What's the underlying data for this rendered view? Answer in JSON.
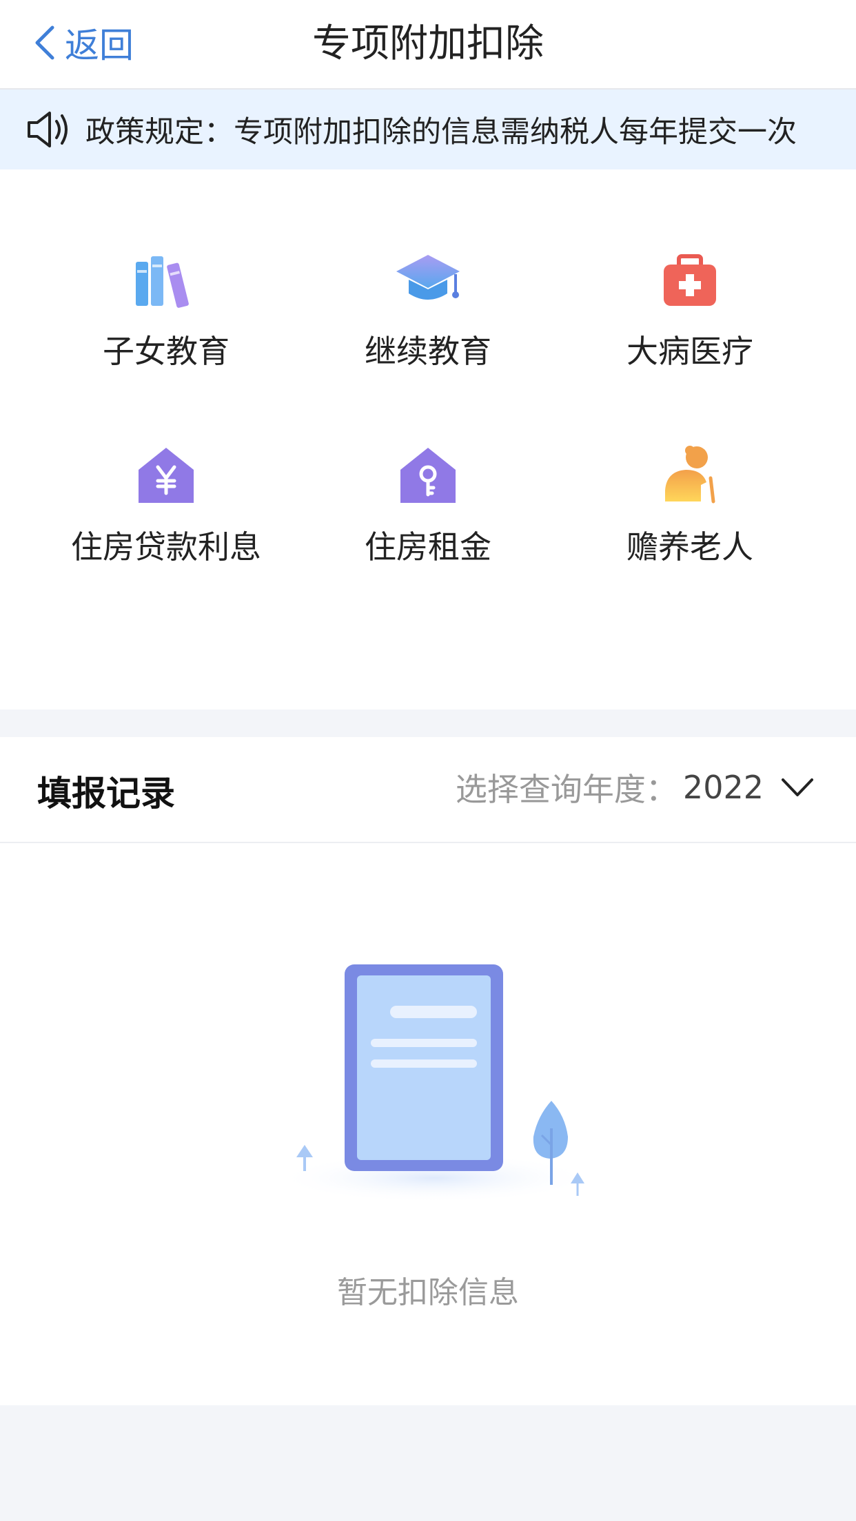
{
  "nav": {
    "back_label": "返回",
    "title": "专项附加扣除"
  },
  "notice": {
    "text": "政策规定：专项附加扣除的信息需纳税人每年提交一次"
  },
  "categories": [
    {
      "label": "子女教育",
      "icon": "books-icon"
    },
    {
      "label": "继续教育",
      "icon": "graduation-cap-icon"
    },
    {
      "label": "大病医疗",
      "icon": "medical-kit-icon"
    },
    {
      "label": "住房贷款利息",
      "icon": "house-yuan-icon"
    },
    {
      "label": "住房租金",
      "icon": "house-key-icon"
    },
    {
      "label": "赡养老人",
      "icon": "elderly-person-icon"
    }
  ],
  "records": {
    "title": "填报记录",
    "year_prefix": "选择查询年度：",
    "year_value": "2022",
    "empty_text": "暂无扣除信息"
  },
  "colors": {
    "accent": "#3f7fd8",
    "notice_bg": "#e9f3ff",
    "page_bg": "#f3f5f9"
  }
}
